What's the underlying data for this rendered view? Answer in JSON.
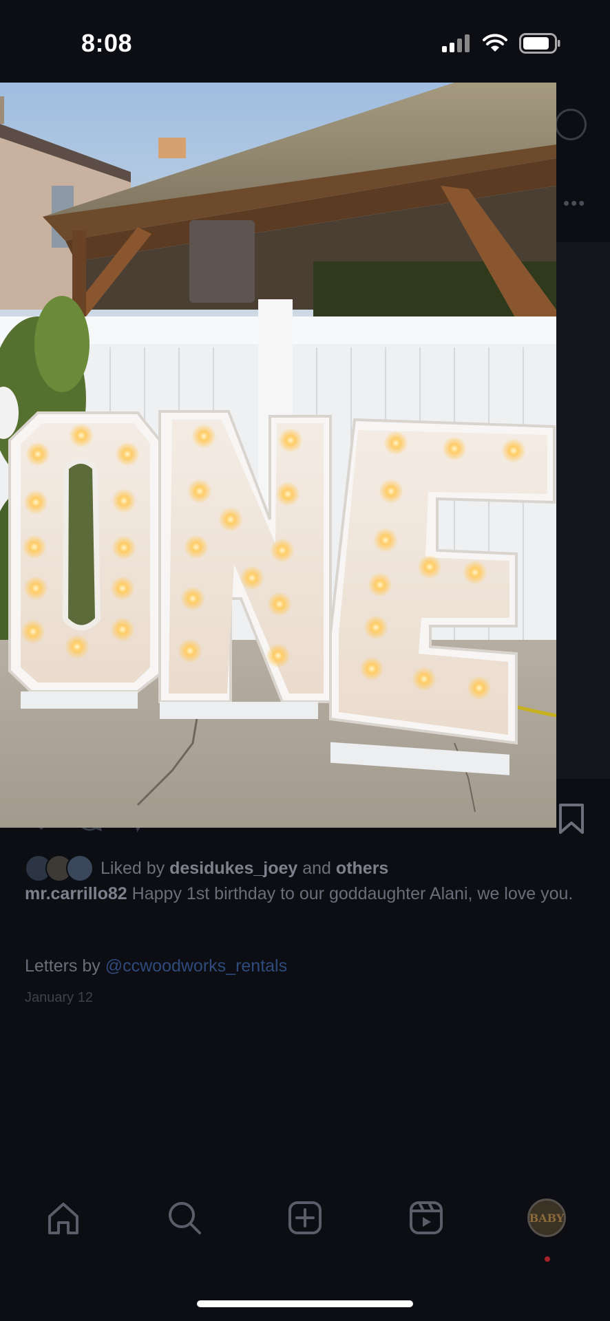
{
  "status_bar": {
    "time": "8:08",
    "battery_icon": "battery-icon",
    "wifi_icon": "wifi-icon",
    "signal_icon": "signal-icon"
  },
  "post": {
    "liked_by_prefix": "Liked by",
    "liked_by_user": "desidukes_joey",
    "liked_by_and": "and",
    "liked_by_others": "others",
    "author": "mr.carrillo82",
    "caption": "Happy 1st birthday to our goddaughter Alani, we love you.",
    "letters_prefix": "Letters by",
    "mention": "@ccwoodworks_rentals",
    "date": "January 12"
  },
  "photo": {
    "letters": "ONE",
    "alt": "Marquee letters spelling ONE"
  },
  "bottom_nav": {
    "items": [
      {
        "name": "home",
        "icon": "home-icon"
      },
      {
        "name": "search",
        "icon": "search-icon"
      },
      {
        "name": "create",
        "icon": "plus-square-icon"
      },
      {
        "name": "reels",
        "icon": "reels-icon"
      },
      {
        "name": "profile",
        "icon": "avatar",
        "avatar_text": "BABY"
      }
    ]
  },
  "colors": {
    "background": "#0c0e14",
    "mention": "#2f4a7c",
    "status_text": "#ffffff"
  }
}
